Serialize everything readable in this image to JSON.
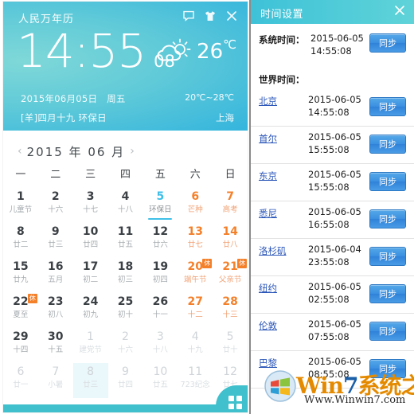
{
  "calendar_app": {
    "title": "人民万年历",
    "header_icons": [
      {
        "name": "feedback-icon",
        "label": "反馈"
      },
      {
        "name": "skin-icon",
        "label": "皮肤"
      },
      {
        "name": "close-icon",
        "label": "关闭"
      }
    ],
    "clock": {
      "hour_minute": "14:55",
      "seconds": "08"
    },
    "weather": {
      "icon": "partly-cloudy-icon",
      "temperature": "26",
      "unit": "℃",
      "range": "20℃~28℃",
      "city": "上海"
    },
    "info": {
      "gregorian": "2015年06月05日　周五",
      "lunar": "[羊]四月十九 环保日"
    },
    "month_nav": {
      "prev": "‹",
      "next": "›",
      "label": "2015 年  06 月"
    },
    "weekdays": [
      "一",
      "二",
      "三",
      "四",
      "五",
      "六",
      "日"
    ],
    "days": [
      {
        "num": "1",
        "sub": "儿童节",
        "type": "normal"
      },
      {
        "num": "2",
        "sub": "十六",
        "type": "normal"
      },
      {
        "num": "3",
        "sub": "十七",
        "type": "normal"
      },
      {
        "num": "4",
        "sub": "十八",
        "type": "normal"
      },
      {
        "num": "5",
        "sub": "环保日",
        "type": "today"
      },
      {
        "num": "6",
        "sub": "芒种",
        "type": "weekend"
      },
      {
        "num": "7",
        "sub": "高考",
        "type": "weekend"
      },
      {
        "num": "8",
        "sub": "廿二",
        "type": "normal"
      },
      {
        "num": "9",
        "sub": "廿三",
        "type": "normal"
      },
      {
        "num": "10",
        "sub": "廿四",
        "type": "normal"
      },
      {
        "num": "11",
        "sub": "廿五",
        "type": "normal"
      },
      {
        "num": "12",
        "sub": "廿六",
        "type": "normal"
      },
      {
        "num": "13",
        "sub": "廿七",
        "type": "weekend"
      },
      {
        "num": "14",
        "sub": "廿八",
        "type": "weekend"
      },
      {
        "num": "15",
        "sub": "廿九",
        "type": "normal"
      },
      {
        "num": "16",
        "sub": "五月",
        "type": "normal"
      },
      {
        "num": "17",
        "sub": "初二",
        "type": "normal"
      },
      {
        "num": "18",
        "sub": "初三",
        "type": "normal"
      },
      {
        "num": "19",
        "sub": "初四",
        "type": "normal"
      },
      {
        "num": "20",
        "sub": "端午节",
        "type": "weekend",
        "badge": "休"
      },
      {
        "num": "21",
        "sub": "父亲节",
        "type": "weekend",
        "badge": "休"
      },
      {
        "num": "22",
        "sub": "夏至",
        "type": "normal",
        "badge": "休"
      },
      {
        "num": "23",
        "sub": "初八",
        "type": "normal"
      },
      {
        "num": "24",
        "sub": "初九",
        "type": "normal"
      },
      {
        "num": "25",
        "sub": "初十",
        "type": "normal"
      },
      {
        "num": "26",
        "sub": "十一",
        "type": "normal"
      },
      {
        "num": "27",
        "sub": "十二",
        "type": "weekend"
      },
      {
        "num": "28",
        "sub": "十三",
        "type": "weekend"
      },
      {
        "num": "29",
        "sub": "十四",
        "type": "normal"
      },
      {
        "num": "30",
        "sub": "十五",
        "type": "normal"
      },
      {
        "num": "1",
        "sub": "建党节",
        "type": "outside"
      },
      {
        "num": "2",
        "sub": "十六",
        "type": "outside"
      },
      {
        "num": "3",
        "sub": "十八",
        "type": "outside"
      },
      {
        "num": "4",
        "sub": "十九",
        "type": "outside"
      },
      {
        "num": "5",
        "sub": "廿十",
        "type": "outside"
      },
      {
        "num": "6",
        "sub": "廿一",
        "type": "outside"
      },
      {
        "num": "7",
        "sub": "小暑",
        "type": "outside"
      },
      {
        "num": "8",
        "sub": "廿三",
        "type": "outside",
        "selected": true
      },
      {
        "num": "9",
        "sub": "廿四",
        "type": "outside"
      },
      {
        "num": "10",
        "sub": "廿五",
        "type": "outside"
      },
      {
        "num": "11",
        "sub": "723纪念",
        "type": "outside"
      },
      {
        "num": "12",
        "sub": "廿七",
        "type": "outside"
      }
    ],
    "footer_icon": "grid-apps-icon"
  },
  "time_panel": {
    "title": "时间设置",
    "close_icon": "close-icon",
    "system_time": {
      "label": "系统时间：",
      "date": "2015-06-05",
      "time": "14:55:08",
      "sync_label": "同步"
    },
    "world_time_label": "世界时间：",
    "sync_label": "同步",
    "cities": [
      {
        "name": "北京",
        "date": "2015-06-05",
        "time": "14:55:08"
      },
      {
        "name": "首尔",
        "date": "2015-06-05",
        "time": "15:55:08"
      },
      {
        "name": "东京",
        "date": "2015-06-05",
        "time": "15:55:08"
      },
      {
        "name": "悉尼",
        "date": "2015-06-05",
        "time": "16:55:08"
      },
      {
        "name": "洛杉矶",
        "date": "2015-06-04",
        "time": "23:55:08"
      },
      {
        "name": "纽约",
        "date": "2015-06-05",
        "time": "02:55:08"
      },
      {
        "name": "伦敦",
        "date": "2015-06-05",
        "time": "07:55:08"
      },
      {
        "name": "巴黎",
        "date": "2015-06-05",
        "time": "08:55:08"
      }
    ]
  },
  "watermark": {
    "brand_prefix": "Win",
    "brand_digit": "7",
    "brand_suffix": "系统之家",
    "url": "Www.Winwin7.com"
  },
  "colors": {
    "header_gradient_start": "#7fd8d8",
    "header_gradient_end": "#28aee0",
    "accent_teal": "#3fc0cc",
    "today_blue": "#3fbfe8",
    "weekend_orange": "#f4802a",
    "rest_badge": "#f4802a",
    "sync_button_blue": "#3a8fe0",
    "link_blue": "#2b56b8"
  }
}
